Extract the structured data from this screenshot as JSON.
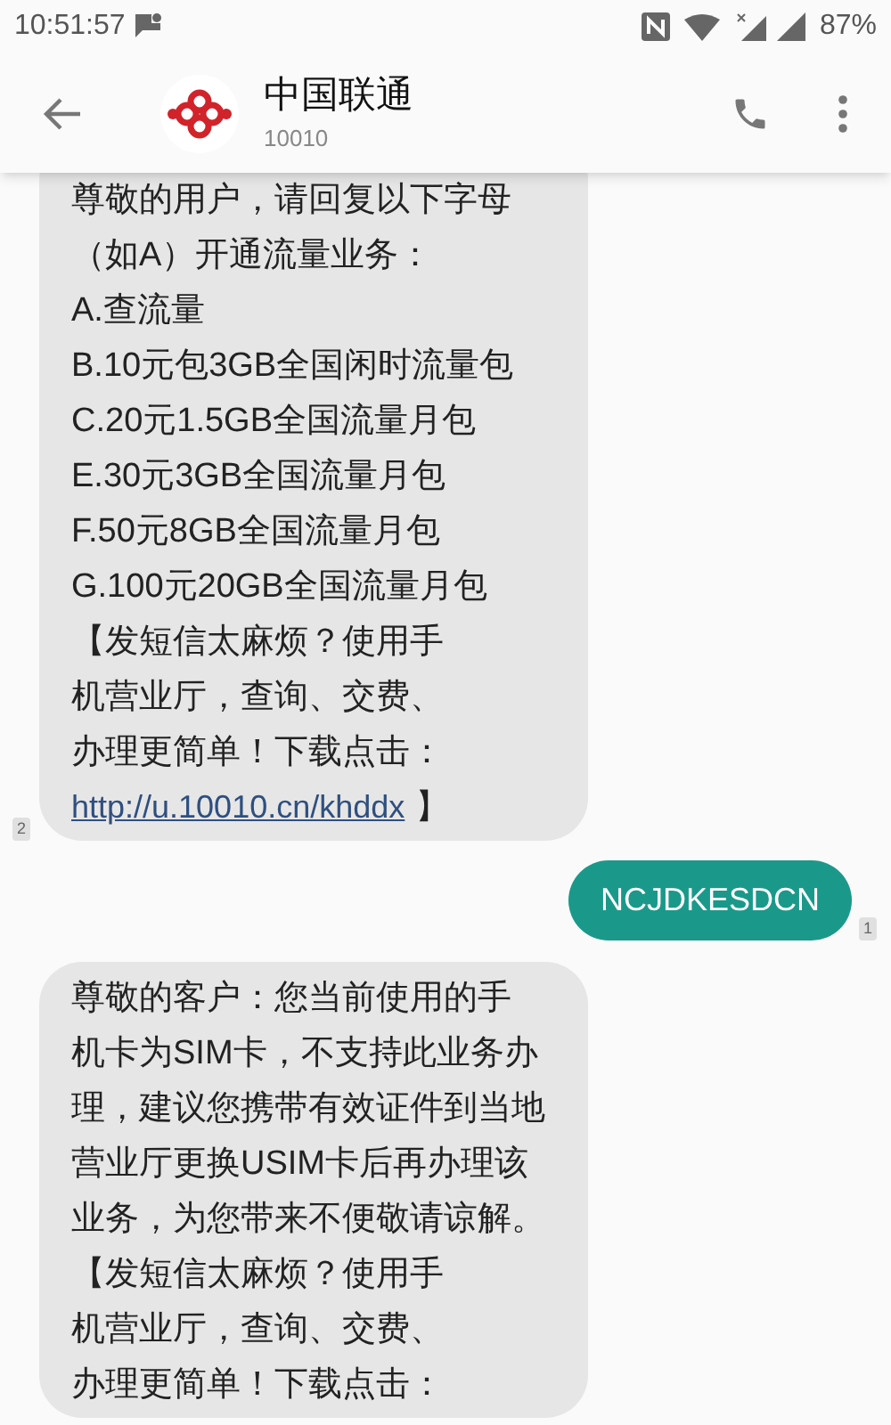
{
  "status_bar": {
    "time": "10:51:57",
    "battery": "87%"
  },
  "header": {
    "title": "中国联通",
    "subtitle": "10010"
  },
  "messages": [
    {
      "kind": "received",
      "badge": "2",
      "lines": [
        "尊敬的用户，请回复以下字母",
        "（如A）开通流量业务：",
        "A.查流量",
        "B.10元包3GB全国闲时流量包",
        "C.20元1.5GB全国流量月包",
        "E.30元3GB全国流量月包",
        "F.50元8GB全国流量月包",
        "G.100元20GB全国流量月包",
        "【发短信太麻烦？使用手",
        "机营业厅，查询、交费、",
        "办理更简单！下载点击："
      ],
      "link": "http://u.10010.cn/khddx",
      "link_suffix": "】"
    },
    {
      "kind": "sent",
      "badge": "1",
      "lines": [
        "NCJDKESDCN"
      ]
    },
    {
      "kind": "received",
      "lines": [
        "尊敬的客户：您当前使用的手",
        "机卡为SIM卡，不支持此业务办",
        "理，建议您携带有效证件到当地",
        "营业厅更换USIM卡后再办理该",
        "业务，为您带来不便敬请谅解。",
        "【发短信太麻烦？使用手",
        "机营业厅，查询、交费、",
        "办理更简单！下载点击："
      ]
    }
  ]
}
